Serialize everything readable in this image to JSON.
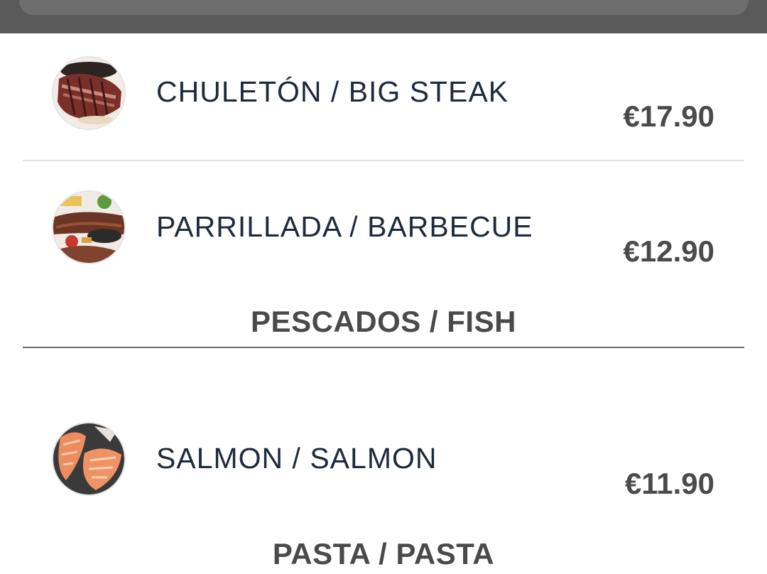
{
  "items": [
    {
      "name": "CHULETÓN / BIG STEAK",
      "price": "€17.90",
      "image": "steak-photo"
    },
    {
      "name": "PARRILLADA / BARBECUE",
      "price": "€12.90",
      "image": "barbecue-photo"
    },
    {
      "name": "SALMON / SALMON",
      "price": "€11.90",
      "image": "salmon-photo"
    }
  ],
  "sections": [
    {
      "title": "PESCADOS / FISH"
    },
    {
      "title": "PASTA / PASTA"
    }
  ],
  "colors": {
    "topbar": "#5a5a5a",
    "item_text": "#1e2a3d",
    "price_text": "#4a4a4a",
    "section_text": "#4a4a4a"
  }
}
